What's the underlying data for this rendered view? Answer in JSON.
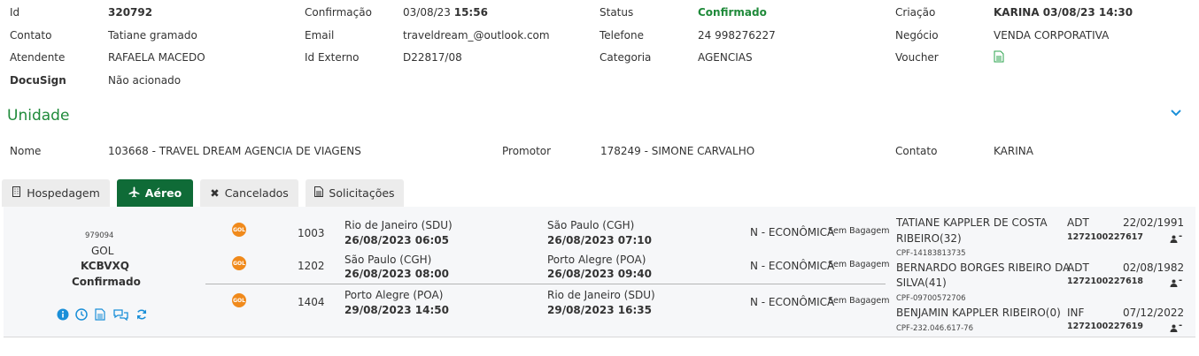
{
  "header": {
    "id_label": "Id",
    "id_value": "320792",
    "contato_label": "Contato",
    "contato_value": "Tatiane gramado",
    "atendente_label": "Atendente",
    "atendente_value": "RAFAELA MACEDO",
    "docusign_label": "DocuSign",
    "docusign_value": "Não acionado",
    "confirmacao_label": "Confirmação",
    "confirmacao_date": "03/08/23",
    "confirmacao_time": "15:56",
    "email_label": "Email",
    "email_value": "traveldream_@outlook.com",
    "id_externo_label": "Id Externo",
    "id_externo_value": "D22817/08",
    "status_label": "Status",
    "status_value": "Confirmado",
    "telefone_label": "Telefone",
    "telefone_value": "24 998276227",
    "categoria_label": "Categoria",
    "categoria_value": "AGENCIAS",
    "criacao_label": "Criação",
    "criacao_value": "KARINA 03/08/23 14:30",
    "negocio_label": "Negócio",
    "negocio_value": "VENDA CORPORATIVA",
    "voucher_label": "Voucher"
  },
  "unidade": {
    "title": "Unidade",
    "nome_label": "Nome",
    "nome_value": "103668 - TRAVEL DREAM AGENCIA DE VIAGENS",
    "promotor_label": "Promotor",
    "promotor_value": "178249 - SIMONE CARVALHO",
    "contato_label": "Contato",
    "contato_value": "KARINA"
  },
  "tabs": [
    {
      "label": "Hospedagem",
      "icon": "building-icon"
    },
    {
      "label": "Aéreo",
      "icon": "plane-icon"
    },
    {
      "label": "Cancelados",
      "icon": "x-icon"
    },
    {
      "label": "Solicitações",
      "icon": "document-icon"
    }
  ],
  "booking": {
    "number": "979094",
    "airline": "GOL",
    "locator": "KCBVXQ",
    "status": "Confirmado",
    "colors": {
      "accent": "#1f8a3a",
      "tab_active": "#0f6b37",
      "action_icon": "#1a8fd8",
      "gol": "#f08a1c"
    },
    "segments": [
      {
        "logo": "GOL",
        "flight": "1003",
        "origin": "Rio de Janeiro (SDU)",
        "departure": "26/08/2023 06:05",
        "destination": "São Paulo (CGH)",
        "arrival": "26/08/2023 07:10",
        "cabin": "N - ECONÔMICA",
        "baggage": "Sem Bagagem"
      },
      {
        "logo": "GOL",
        "flight": "1202",
        "origin": "São Paulo (CGH)",
        "departure": "26/08/2023 08:00",
        "destination": "Porto Alegre (POA)",
        "arrival": "26/08/2023 09:40",
        "cabin": "N - ECONÔMICA",
        "baggage": "Sem Bagagem"
      },
      {
        "logo": "GOL",
        "flight": "1404",
        "origin": "Porto Alegre (POA)",
        "departure": "29/08/2023 14:50",
        "destination": "Rio de Janeiro (SDU)",
        "arrival": "29/08/2023 16:35",
        "cabin": "N - ECONÔMICA",
        "baggage": "Sem Bagagem"
      }
    ],
    "passengers": [
      {
        "name1": "TATIANE KAPPLER DE COSTA",
        "name2": "RIBEIRO(32)",
        "cpf": "CPF-14183813735",
        "type": "ADT",
        "birth": "22/02/1991",
        "ticket": "1272100227617",
        "dash": "-"
      },
      {
        "name1": "BERNARDO BORGES RIBEIRO DA",
        "name2": "SILVA(41)",
        "cpf": "CPF-09700572706",
        "type": "ADT",
        "birth": "02/08/1982",
        "ticket": "1272100227618",
        "dash": "-"
      },
      {
        "name1": "BENJAMIN KAPPLER RIBEIRO(0)",
        "name2": "",
        "cpf": "CPF-232.046.617-76",
        "type": "INF",
        "birth": "07/12/2022",
        "ticket": "1272100227619",
        "dash": "-"
      }
    ]
  }
}
